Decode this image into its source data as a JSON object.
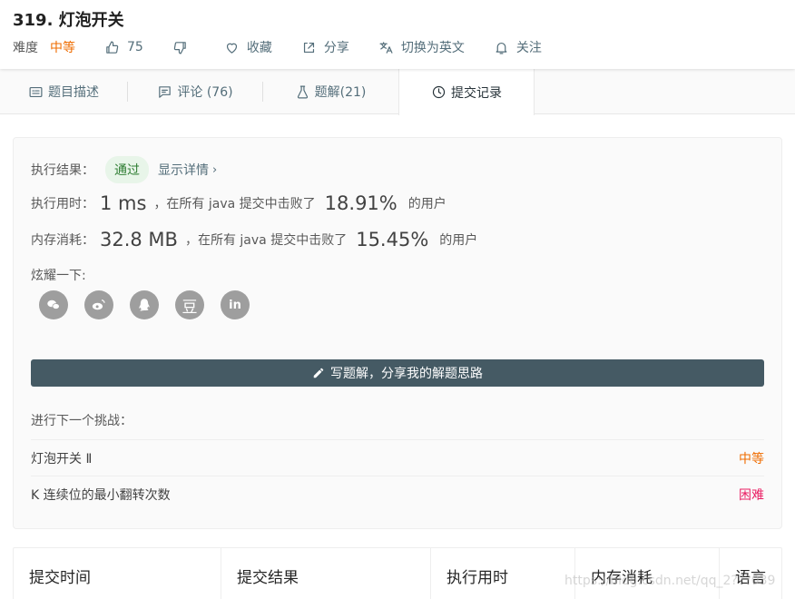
{
  "problem": {
    "title": "319. 灯泡开关",
    "difficulty_label": "难度",
    "difficulty": "中等",
    "likes": "75",
    "favorite_label": "收藏",
    "share_label": "分享",
    "switch_lang_label": "切换为英文",
    "follow_label": "关注"
  },
  "tabs": [
    {
      "label": "题目描述",
      "icon": "description-icon"
    },
    {
      "label": "评论 (76)",
      "icon": "comment-icon"
    },
    {
      "label": "题解(21)",
      "icon": "flask-icon"
    },
    {
      "label": "提交记录",
      "icon": "clock-icon",
      "active": true
    }
  ],
  "result": {
    "result_label": "执行结果：",
    "status": "通过",
    "details_link": "显示详情",
    "time_label": "执行用时：",
    "time_value": "1 ms",
    "time_text": "，在所有 java 提交中击败了",
    "time_percent": "18.91%",
    "time_suffix": "的用户",
    "mem_label": "内存消耗：",
    "mem_value": "32.8 MB",
    "mem_text": "，在所有 java 提交中击败了",
    "mem_percent": "15.45%",
    "mem_suffix": "的用户",
    "share_label": "炫耀一下:",
    "share_icons": [
      "wechat-icon",
      "weibo-icon",
      "qq-icon",
      "douban-icon",
      "linkedin-icon"
    ],
    "douban_glyph": "豆",
    "linkedin_glyph": "in",
    "write_button": "写题解，分享我的解题思路",
    "next_label": "进行下一个挑战：",
    "challenges": [
      {
        "name": "灯泡开关 Ⅱ",
        "level": "中等"
      },
      {
        "name": "K 连续位的最小翻转次数",
        "level": "困难"
      }
    ]
  },
  "table": {
    "headers": [
      "提交时间",
      "提交结果",
      "执行用时",
      "内存消耗",
      "语言"
    ]
  },
  "watermark": "https://blog.csdn.net/qq_2???039"
}
